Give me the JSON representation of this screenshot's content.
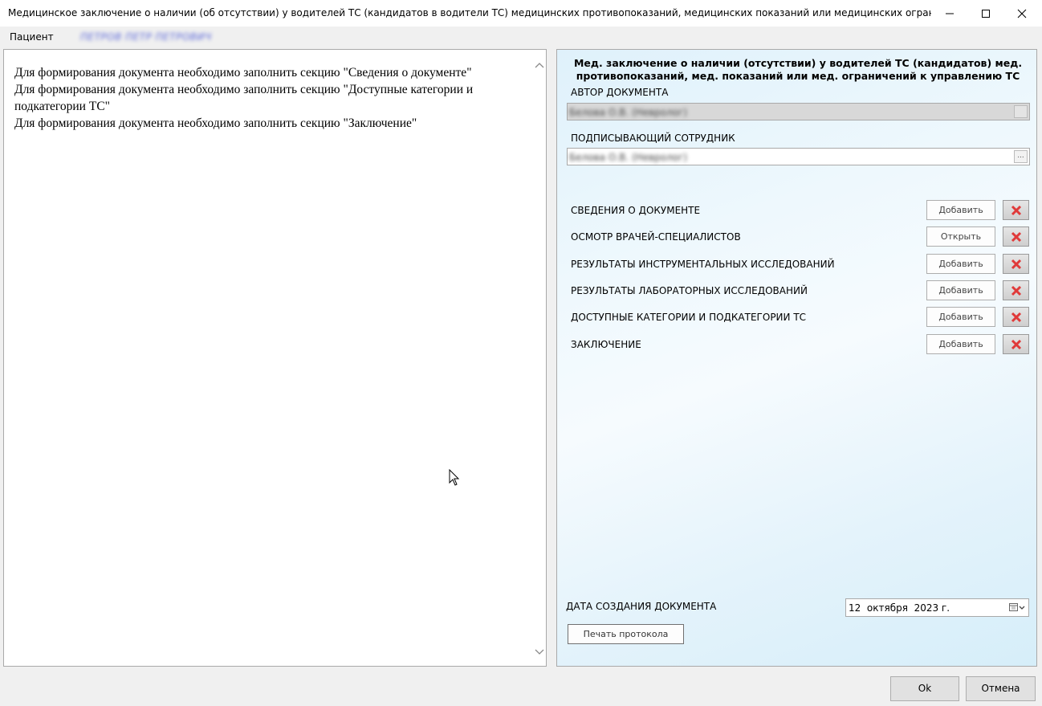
{
  "window": {
    "title": "Медицинское заключение о наличии (об отсутствии) у водителей ТС (кандидатов в водители ТС) медицинских противопоказаний, медицинских показаний или медицинских ограничений к управлению ТС ..."
  },
  "patient": {
    "label": "Пациент",
    "name": "ПЕТРОВ ПЕТР ПЕТРОВИЧ"
  },
  "messages": [
    "Для формирования документа необходимо заполнить секцию \"Сведения о документе\"",
    "Для формирования документа необходимо заполнить секцию \"Доступные категории и подкатегории ТС\"",
    "Для формирования документа необходимо заполнить секцию \"Заключение\""
  ],
  "form": {
    "title": "Мед. заключение о наличии (отсутствии) у водителей ТС (кандидатов) мед. противопоказаний, мед. показаний или мед. ограничений к управлению ТС",
    "author_label": "АВТОР ДОКУМЕНТА",
    "author_value": "Белова О.В. (Невролог)",
    "signer_label": "ПОДПИСЫВАЮЩИЙ СОТРУДНИК",
    "signer_value": "Белова О.В. (Невролог)",
    "ellipsis": "...",
    "sections": [
      {
        "label": "СВЕДЕНИЯ О ДОКУМЕНТЕ",
        "action": "Добавить"
      },
      {
        "label": "ОСМОТР ВРАЧЕЙ-СПЕЦИАЛИСТОВ",
        "action": "Открыть"
      },
      {
        "label": "РЕЗУЛЬТАТЫ ИНСТРУМЕНТАЛЬНЫХ ИССЛЕДОВАНИЙ",
        "action": "Добавить"
      },
      {
        "label": "РЕЗУЛЬТАТЫ ЛАБОРАТОРНЫХ ИССЛЕДОВАНИЙ",
        "action": "Добавить"
      },
      {
        "label": "ДОСТУПНЫЕ КАТЕГОРИИ И ПОДКАТЕГОРИИ ТС",
        "action": "Добавить"
      },
      {
        "label": "ЗАКЛЮЧЕНИЕ",
        "action": "Добавить"
      }
    ],
    "date_label": "ДАТА СОЗДАНИЯ ДОКУМЕНТА",
    "date_value": "12  октября  2023 г.",
    "print_button": "Печать протокола"
  },
  "buttons": {
    "ok": "Ok",
    "cancel": "Отмена"
  },
  "icons": {
    "minimize": "minimize-icon",
    "maximize": "maximize-icon",
    "close": "close-icon",
    "delete": "red-x-delete-icon",
    "calendar": "calendar-dropdown-icon",
    "scroll_up": "chevron-up-icon",
    "scroll_down": "chevron-down-icon",
    "cursor": "mouse-pointer-icon"
  },
  "colors": {
    "delete_icon": "#e03a3a",
    "patient_name": "#5865d8"
  }
}
